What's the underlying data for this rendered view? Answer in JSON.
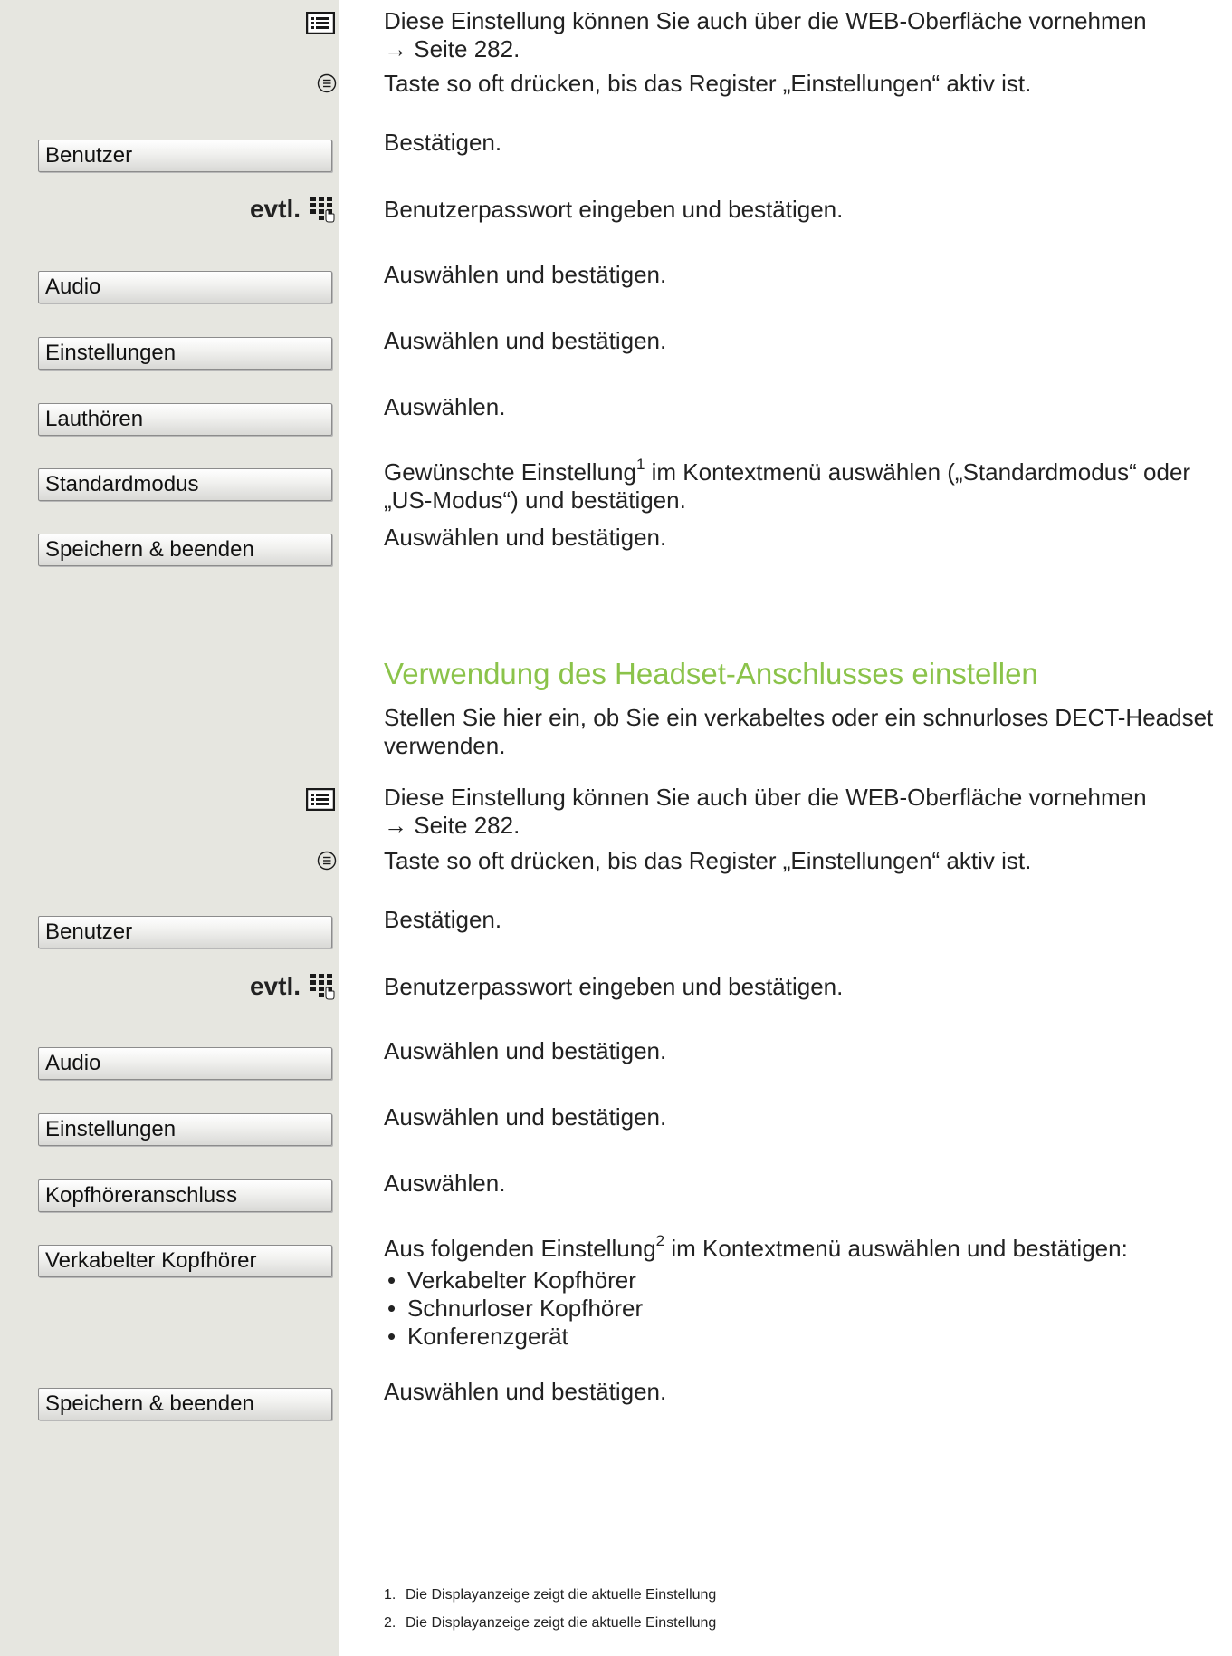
{
  "section1": {
    "web_text": "Diese Einstellung können Sie auch über die WEB-Oberfläche vornehmen",
    "web_ref": "→ Seite 282.",
    "menu_key_text": "Taste so oft drücken, bis das Register „Einstellungen“ aktiv ist.",
    "btn_benutzer": "Benutzer",
    "benutzer_text": "Bestätigen.",
    "evtl_label": "evtl.",
    "password_text": "Benutzerpasswort eingeben und bestätigen.",
    "btn_audio": "Audio",
    "audio_text": "Auswählen und bestätigen.",
    "btn_einstellungen": "Einstellungen",
    "einstellungen_text": "Auswählen und bestätigen.",
    "btn_lauthoeren": "Lauthören",
    "lauthoeren_text": "Auswählen.",
    "btn_standardmodus": "Standardmodus",
    "standardmodus_text_a": "Gewünschte Einstellung",
    "standardmodus_sup": "1",
    "standardmodus_text_b": " im Kontextmenü auswählen („Standardmodus“ oder „US-Modus“) und bestätigen.",
    "btn_speichern": "Speichern & beenden",
    "speichern_text": "Auswählen und bestätigen."
  },
  "section2": {
    "heading": "Verwendung des Headset-Anschlusses einstellen",
    "intro": "Stellen Sie hier ein, ob Sie ein verkabeltes oder ein schnurloses DECT-Headset verwenden.",
    "web_text": "Diese Einstellung können Sie auch über die WEB-Oberfläche vornehmen",
    "web_ref": "→ Seite 282.",
    "menu_key_text": "Taste so oft drücken, bis das Register „Einstellungen“ aktiv ist.",
    "btn_benutzer": "Benutzer",
    "benutzer_text": "Bestätigen.",
    "evtl_label": "evtl.",
    "password_text": "Benutzerpasswort eingeben und bestätigen.",
    "btn_audio": "Audio",
    "audio_text": "Auswählen und bestätigen.",
    "btn_einstellungen": "Einstellungen",
    "einstellungen_text": "Auswählen und bestätigen.",
    "btn_kopfhoereranschluss": "Kopfhöreranschluss",
    "kopfhoereranschluss_text": "Auswählen.",
    "btn_verkabelter": "Verkabelter Kopfhörer",
    "verkabelter_text_a": "Aus folgenden Einstellung",
    "verkabelter_sup": "2",
    "verkabelter_text_b": " im Kontextmenü auswählen und bestätigen:",
    "options": [
      "Verkabelter Kopfhörer",
      "Schnurloser Kopfhörer",
      "Konferenzgerät"
    ],
    "btn_speichern": "Speichern & beenden",
    "speichern_text": "Auswählen und bestätigen."
  },
  "footnotes": [
    {
      "num": "1.",
      "text": "Die Displayanzeige zeigt die aktuelle Einstellung"
    },
    {
      "num": "2.",
      "text": "Die Displayanzeige zeigt die aktuelle Einstellung"
    }
  ]
}
